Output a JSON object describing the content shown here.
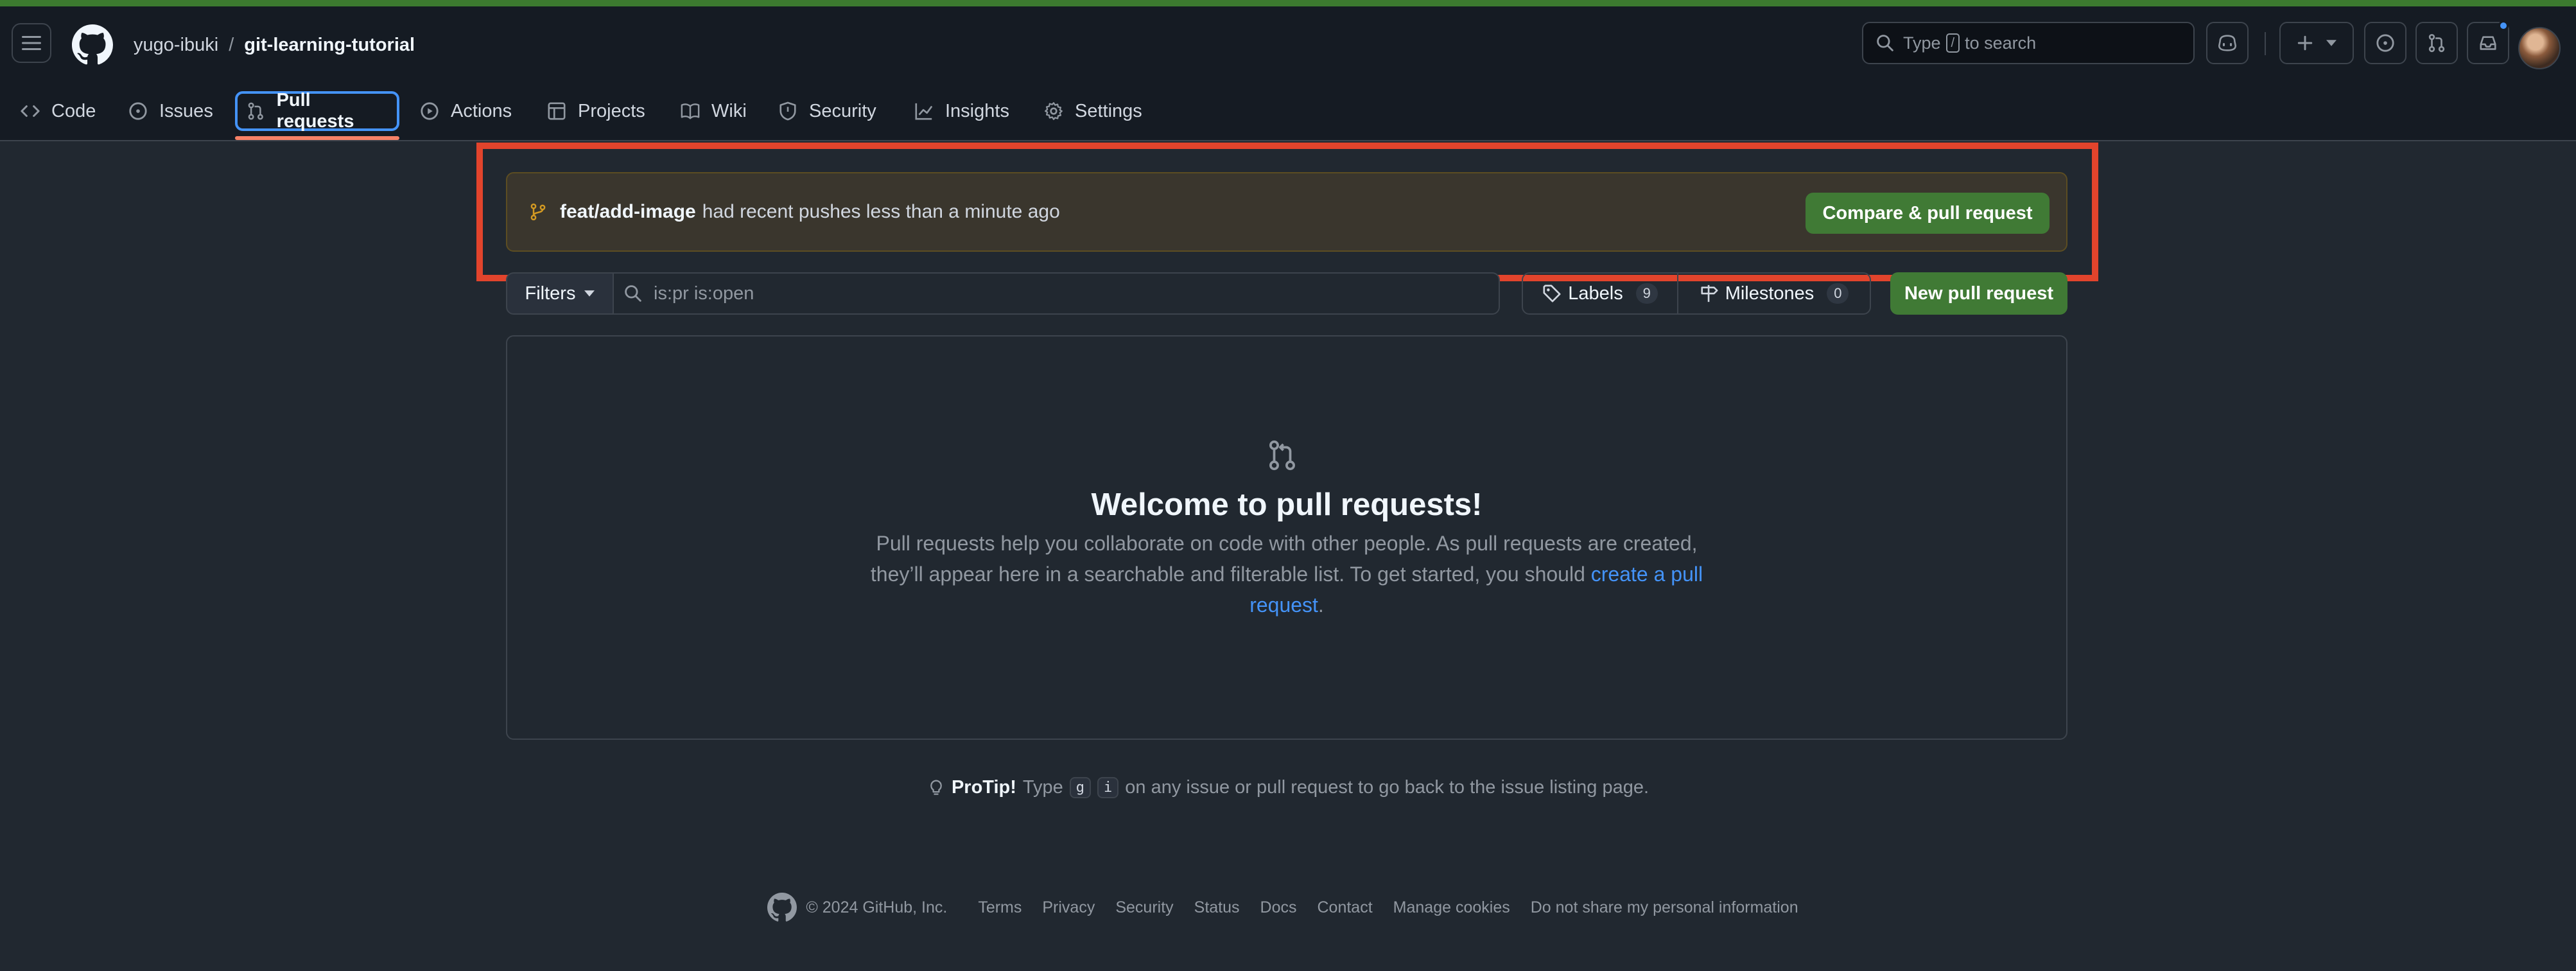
{
  "header": {
    "owner": "yugo-ibuki",
    "separator": "/",
    "repo": "git-learning-tutorial",
    "search_prefix": "Type",
    "search_key": "/",
    "search_suffix": "to search"
  },
  "nav": {
    "code": "Code",
    "issues": "Issues",
    "pull_requests": "Pull requests",
    "actions": "Actions",
    "projects": "Projects",
    "wiki": "Wiki",
    "security": "Security",
    "insights": "Insights",
    "settings": "Settings"
  },
  "banner": {
    "branch": "feat/add-image",
    "message": "had recent pushes less than a minute ago",
    "button": "Compare & pull request"
  },
  "filters": {
    "label": "Filters",
    "query": "is:pr is:open",
    "labels_label": "Labels",
    "labels_count": "9",
    "milestones_label": "Milestones",
    "milestones_count": "0",
    "new_pr": "New pull request"
  },
  "blankslate": {
    "title": "Welcome to pull requests!",
    "text": "Pull requests help you collaborate on code with other people. As pull requests are created, they’ll appear here in a searchable and filterable list. To get started, you should",
    "link": "create a pull request",
    "period": "."
  },
  "protip": {
    "label": "ProTip!",
    "pre": "Type",
    "key1": "g",
    "key2": "i",
    "post": "on any issue or pull request to go back to the issue listing page."
  },
  "footer": {
    "copyright": "© 2024 GitHub, Inc.",
    "links": [
      "Terms",
      "Privacy",
      "Security",
      "Status",
      "Docs",
      "Contact",
      "Manage cookies",
      "Do not share my personal information"
    ]
  },
  "colors": {
    "accent_green": "#407a35",
    "highlight_red": "#e2442c",
    "link_blue": "#4493f8",
    "tab_underline": "#f78166"
  }
}
